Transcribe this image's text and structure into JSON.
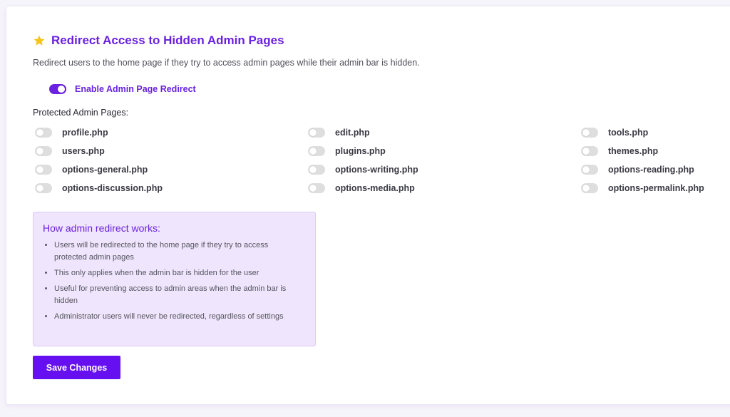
{
  "colors": {
    "accent": "#6a21e0",
    "button": "#6610f2",
    "info_background": "#efe5fc",
    "toggle_off": "#dedede",
    "star": "#f5c518"
  },
  "header": {
    "icon": "star-icon",
    "title": "Redirect Access to Hidden Admin Pages",
    "description": "Redirect users to the home page if they try to access admin pages while their admin bar is hidden."
  },
  "enable_toggle": {
    "label": "Enable Admin Page Redirect",
    "checked": true
  },
  "protected_pages": {
    "label": "Protected Admin Pages:",
    "items": [
      {
        "label": "profile.php",
        "checked": false
      },
      {
        "label": "edit.php",
        "checked": false
      },
      {
        "label": "tools.php",
        "checked": false
      },
      {
        "label": "users.php",
        "checked": false
      },
      {
        "label": "plugins.php",
        "checked": false
      },
      {
        "label": "themes.php",
        "checked": false
      },
      {
        "label": "options-general.php",
        "checked": false
      },
      {
        "label": "options-writing.php",
        "checked": false
      },
      {
        "label": "options-reading.php",
        "checked": false
      },
      {
        "label": "options-discussion.php",
        "checked": false
      },
      {
        "label": "options-media.php",
        "checked": false
      },
      {
        "label": "options-permalink.php",
        "checked": false
      }
    ]
  },
  "info": {
    "title": "How admin redirect works:",
    "items": [
      "Users will be redirected to the home page if they try to access protected admin pages",
      "This only applies when the admin bar is hidden for the user",
      "Useful for preventing access to admin areas when the admin bar is hidden",
      "Administrator users will never be redirected, regardless of settings"
    ]
  },
  "save_button": {
    "label": "Save Changes"
  }
}
